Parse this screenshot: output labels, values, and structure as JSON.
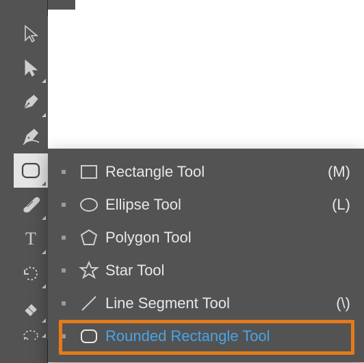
{
  "toolbar": {
    "tools": [
      {
        "name": "selection-tool",
        "has_submenu": false
      },
      {
        "name": "direct-selection-tool",
        "has_submenu": true
      },
      {
        "name": "pen-tool",
        "has_submenu": true
      },
      {
        "name": "curvature-tool",
        "has_submenu": false
      },
      {
        "name": "rectangle-tool",
        "has_submenu": true,
        "active": true
      },
      {
        "name": "paintbrush-tool",
        "has_submenu": true
      },
      {
        "name": "type-tool",
        "has_submenu": true
      },
      {
        "name": "rotate-tool",
        "has_submenu": true
      },
      {
        "name": "eraser-tool",
        "has_submenu": true
      },
      {
        "name": "lasso-tool",
        "has_submenu": true
      }
    ]
  },
  "flyout": {
    "items": [
      {
        "label": "Rectangle Tool",
        "shortcut": "(M)",
        "icon": "rectangle"
      },
      {
        "label": "Ellipse Tool",
        "shortcut": "(L)",
        "icon": "ellipse"
      },
      {
        "label": "Polygon Tool",
        "shortcut": "",
        "icon": "polygon"
      },
      {
        "label": "Star Tool",
        "shortcut": "",
        "icon": "star"
      },
      {
        "label": "Line Segment Tool",
        "shortcut": "(\\)",
        "icon": "line"
      },
      {
        "label": "Rounded Rectangle Tool",
        "shortcut": "",
        "icon": "rounded-rectangle",
        "highlighted": true
      }
    ]
  },
  "colors": {
    "panel": "#535353",
    "active_bg": "#e5e5e5",
    "highlight_text": "#4aa3e8",
    "callout_border": "#e67a1a"
  }
}
